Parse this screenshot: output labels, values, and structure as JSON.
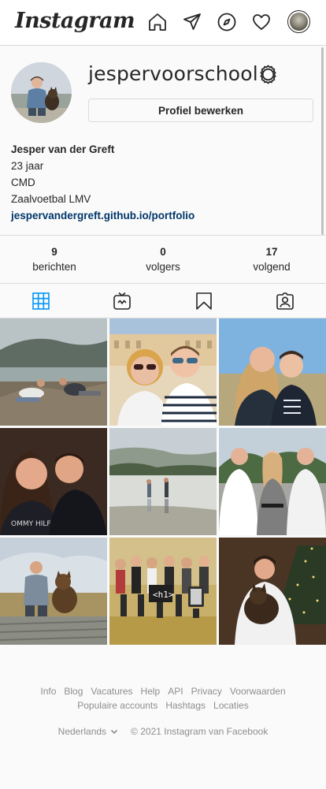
{
  "app": {
    "logo": "Instagram"
  },
  "nav": {
    "icons": [
      "home-icon",
      "direct-message-icon",
      "explore-compass-icon",
      "activity-heart-icon"
    ],
    "avatar_icon": "profile-avatar"
  },
  "profile": {
    "username": "jespervoorschool",
    "edit_label": "Profiel bewerken",
    "bio": {
      "name": "Jesper van der Greft",
      "lines": [
        "23 jaar",
        "CMD",
        "Zaalvoetbal LMV"
      ],
      "link": "jespervandergreft.github.io/portfolio"
    }
  },
  "stats": [
    {
      "value": "9",
      "label": "berichten"
    },
    {
      "value": "0",
      "label": "volgers"
    },
    {
      "value": "17",
      "label": "volgend"
    }
  ],
  "tabs": [
    {
      "icon": "posts-grid-icon",
      "active": true
    },
    {
      "icon": "igtv-icon",
      "active": false
    },
    {
      "icon": "saved-bookmark-icon",
      "active": false
    },
    {
      "icon": "tagged-icon",
      "active": false
    }
  ],
  "posts": [
    "mountain-lake-friends",
    "palace-selfie",
    "beach-selfie",
    "night-selfie",
    "lake-reflection",
    "formal-trio",
    "dog-on-dock",
    "group-event",
    "christmas-tree-dog"
  ],
  "colors": {
    "accent": "#0095f6",
    "link": "#00376b",
    "text": "#262626",
    "muted": "#8e8e8e",
    "border": "#dbdbdb"
  },
  "footer": {
    "links": [
      "Info",
      "Blog",
      "Vacatures",
      "Help",
      "API",
      "Privacy",
      "Voorwaarden",
      "Populaire accounts",
      "Hashtags",
      "Locaties"
    ],
    "language": "Nederlands",
    "copyright": "© 2021 Instagram van Facebook"
  }
}
